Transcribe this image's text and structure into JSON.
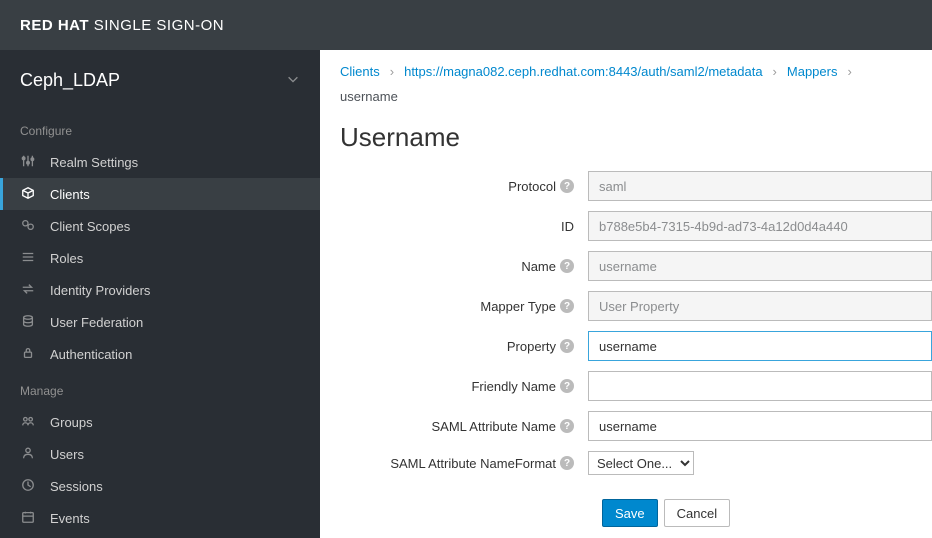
{
  "brand": {
    "part1": "RED HAT",
    "part2": " SINGLE SIGN-ON"
  },
  "realm": {
    "name": "Ceph_LDAP"
  },
  "sidebar": {
    "configure_label": "Configure",
    "manage_label": "Manage",
    "configure": [
      {
        "label": "Realm Settings"
      },
      {
        "label": "Clients"
      },
      {
        "label": "Client Scopes"
      },
      {
        "label": "Roles"
      },
      {
        "label": "Identity Providers"
      },
      {
        "label": "User Federation"
      },
      {
        "label": "Authentication"
      }
    ],
    "manage": [
      {
        "label": "Groups"
      },
      {
        "label": "Users"
      },
      {
        "label": "Sessions"
      },
      {
        "label": "Events"
      }
    ]
  },
  "breadcrumb": {
    "items": [
      {
        "text": "Clients",
        "link": true
      },
      {
        "text": "https://magna082.ceph.redhat.com:8443/auth/saml2/metadata",
        "link": true
      },
      {
        "text": "Mappers",
        "link": true
      },
      {
        "text": "username",
        "link": false
      }
    ],
    "sep": "›"
  },
  "page": {
    "title": "Username"
  },
  "form": {
    "rows": {
      "protocol": {
        "label": "Protocol",
        "help": true,
        "value": "saml",
        "readonly": true
      },
      "id": {
        "label": "ID",
        "help": false,
        "value": "b788e5b4-7315-4b9d-ad73-4a12d0d4a440",
        "readonly": true
      },
      "name": {
        "label": "Name",
        "help": true,
        "value": "username",
        "readonly": true
      },
      "mapper_type": {
        "label": "Mapper Type",
        "help": true,
        "value": "User Property",
        "readonly": true
      },
      "property": {
        "label": "Property",
        "help": true,
        "value": "username",
        "readonly": false,
        "active": true
      },
      "friendly_name": {
        "label": "Friendly Name",
        "help": true,
        "value": "",
        "readonly": false
      },
      "saml_attr_name": {
        "label": "SAML Attribute Name",
        "help": true,
        "value": "username",
        "readonly": false
      },
      "saml_attr_fmt": {
        "label": "SAML Attribute NameFormat",
        "help": true,
        "value": "Select One...",
        "type": "select"
      }
    },
    "actions": {
      "save": "Save",
      "cancel": "Cancel"
    }
  }
}
